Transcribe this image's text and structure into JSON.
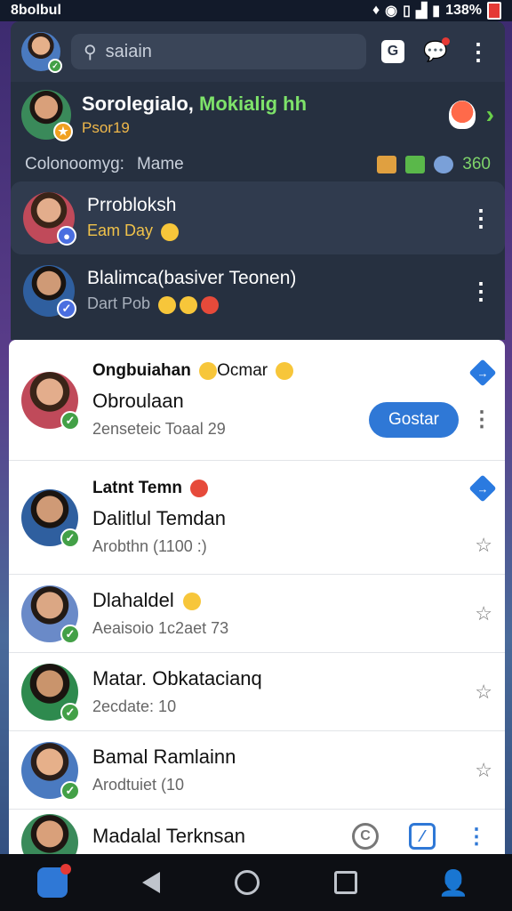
{
  "status_bar": {
    "carrier": "8bolbul",
    "battery_text": "138%"
  },
  "header": {
    "search_placeholder": "saiain"
  },
  "profile": {
    "name_prefix": "Sorolegialo,",
    "name_highlight": "Mokialig hh",
    "subtitle": "Psor19"
  },
  "category": {
    "label": "Colonoomyg:",
    "value": "Mame",
    "count": "360"
  },
  "dark_items": [
    {
      "title": "Prrobloksh",
      "subtitle": "Eam Day"
    },
    {
      "title": "Blalimca(basiver Teonen)",
      "subtitle": "Dart Pob"
    }
  ],
  "list": {
    "items": [
      {
        "heading": "Ongbuiahan",
        "heading_extra": "Ocmar",
        "name": "Obroulaan",
        "sub": "2enseteic Toaal 29",
        "action": "Gostar"
      },
      {
        "heading": "Latnt Temn",
        "name": "Dalitlul Temdan",
        "sub": "Arobthn (1100     :)"
      },
      {
        "name": "Dlahaldel",
        "sub": "Aeaisoio 1c2aet 73"
      },
      {
        "name": "Matar. Obkatacianq",
        "sub": "2ecdate: 10"
      },
      {
        "name": "Bamal Ramlainn",
        "sub": "Arodtuiet (10"
      },
      {
        "name": "Madalal Terknsan"
      }
    ]
  }
}
